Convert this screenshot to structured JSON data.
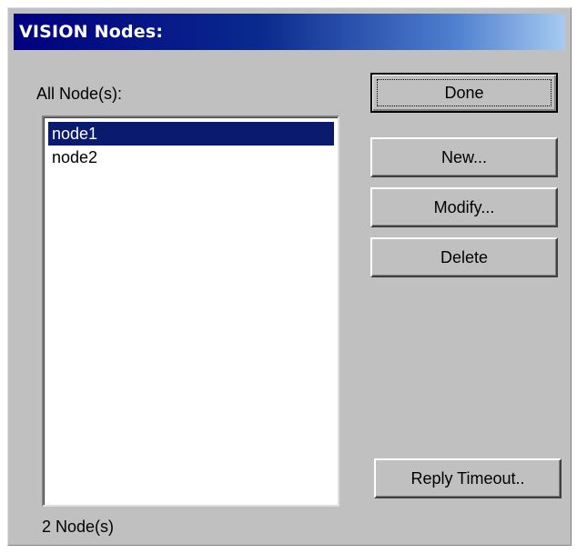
{
  "dialog": {
    "title": "VISION Nodes:"
  },
  "nodes": {
    "list_label": "All Node(s):",
    "items": [
      {
        "label": "node1",
        "selected": true
      },
      {
        "label": "node2",
        "selected": false
      }
    ],
    "count_label": "2 Node(s)"
  },
  "buttons": {
    "done": "Done",
    "new": "New...",
    "modify": "Modify...",
    "delete": "Delete",
    "reply_timeout": "Reply Timeout.."
  },
  "colors": {
    "title_bar_start": "#00007f",
    "title_bar_end": "#a6caf0",
    "dialog_face": "#c0c0c0",
    "selection": "#0a1a6e"
  }
}
